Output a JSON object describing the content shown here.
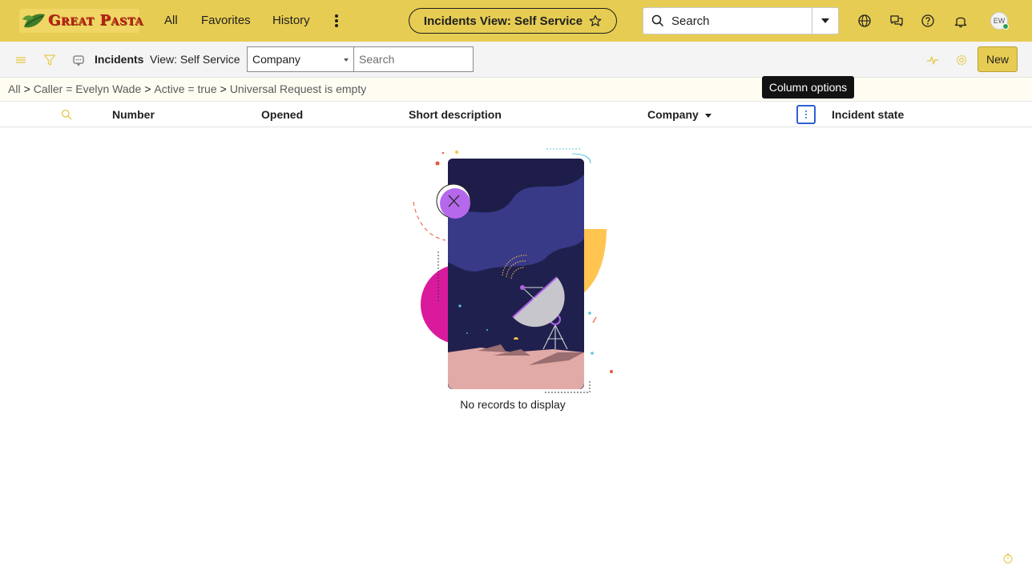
{
  "header": {
    "logo_text": "Great Pasta",
    "nav": [
      {
        "label": "All"
      },
      {
        "label": "Favorites"
      },
      {
        "label": "History"
      }
    ],
    "view_pill_label": "Incidents View: Self Service",
    "search": {
      "label": "Search"
    },
    "user_initials": "EW",
    "icons": [
      "globe-icon",
      "chat-icon",
      "help-icon",
      "bell-icon"
    ],
    "accent_color": "#e6cc52"
  },
  "toolbar": {
    "title": "Incidents",
    "view_label": "View: Self Service",
    "field_selected": "Company",
    "search_placeholder": "Search",
    "new_label": "New"
  },
  "breadcrumb": {
    "items": [
      "All",
      "Caller = Evelyn Wade",
      "Active = true",
      "Universal Request is empty"
    ],
    "separator": ">"
  },
  "tooltip": "Column options",
  "columns": [
    "Number",
    "Opened",
    "Short description",
    "Company",
    "Incident state"
  ],
  "sorted_column": "Company",
  "empty_message": "No records to display"
}
